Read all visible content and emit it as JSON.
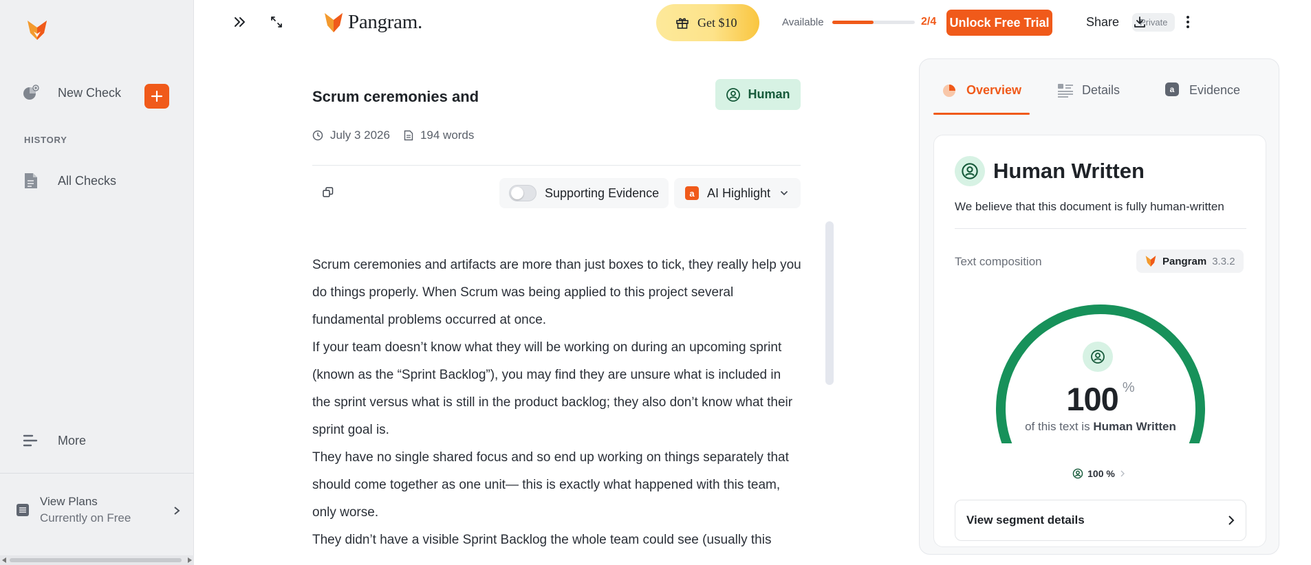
{
  "sidebar": {
    "new_check": "New Check",
    "history_heading": "HISTORY",
    "all_checks": "All Checks",
    "more": "More",
    "plans_title": "View Plans",
    "plans_subtitle": "Currently on Free"
  },
  "topbar": {
    "brand": "Pangram.",
    "promo": "Get $10",
    "available_label": "Available",
    "usage_fraction": 0.5,
    "usage_count": "2/4",
    "unlock": "Unlock Free Trial",
    "share": "Share",
    "privacy": "Private"
  },
  "document": {
    "title": "Scrum ceremonies and",
    "badge": "Human",
    "date": "July 3 2026",
    "words": "194 words",
    "supporting_evidence": "Supporting Evidence",
    "ai_highlight": "AI Highlight",
    "paragraphs": [
      "Scrum ceremonies and artifacts are more than just boxes to tick, they really help you do things properly. When Scrum was being applied to this project several fundamental problems occurred at once.",
      "If your team doesn’t know what they will be working on during an upcoming sprint (known as the “Sprint Backlog”), you may find they are unsure what is included in the sprint versus what is still in the product backlog; they also don’t know what their sprint goal is.",
      "They have no single shared focus and so end up working on things separately that should come together as one unit— this is exactly what happened with this team, only worse.",
      "They didn’t have a visible Sprint Backlog the whole team could see (usually this"
    ]
  },
  "panel": {
    "tabs": [
      "Overview",
      "Details",
      "Evidence"
    ],
    "active_tab": "Overview",
    "result_title": "Human Written",
    "result_desc": "We believe that this document is fully human-written",
    "composition_label": "Text composition",
    "model_name": "Pangram",
    "model_version": "3.3.2",
    "gauge_value": "100",
    "gauge_unit": "%",
    "gauge_fraction": 1.0,
    "gauge_caption_prefix": "of this text is",
    "gauge_caption_strong": "Human Written",
    "small_stat": "100 %",
    "segment_details": "View segment details"
  },
  "colors": {
    "accent": "#f05a1a",
    "human_green": "#17915a",
    "human_bg": "#d7f2e4"
  }
}
